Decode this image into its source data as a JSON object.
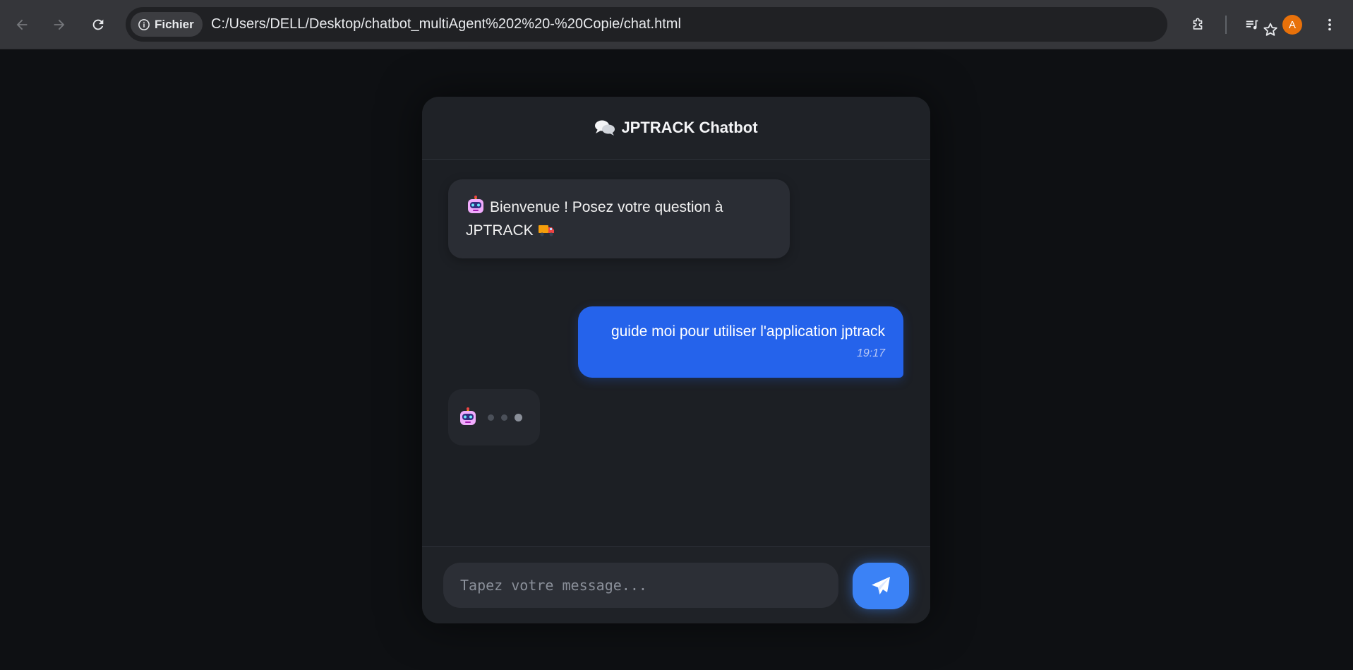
{
  "browser": {
    "site_label": "Fichier",
    "url": "C:/Users/DELL/Desktop/chatbot_multiAgent%202%20-%20Copie/chat.html",
    "profile_initial": "A",
    "profile_color": "#e8710a"
  },
  "chat": {
    "title": "JPTRACK Chatbot",
    "title_icon": "comments-icon",
    "messages": [
      {
        "sender": "bot",
        "text_line1": "Bienvenue ! Posez votre question à",
        "text_line2": "JPTRACK"
      },
      {
        "sender": "user",
        "text": "guide moi pour utiliser l'application jptrack",
        "time": "19:17"
      }
    ],
    "typing": true,
    "input_placeholder": "Tapez votre message...",
    "input_value": ""
  },
  "colors": {
    "accent": "#3b82f6",
    "user_bubble": "#2563eb",
    "card_bg": "#1c1f24",
    "page_bg": "#0e1013"
  }
}
